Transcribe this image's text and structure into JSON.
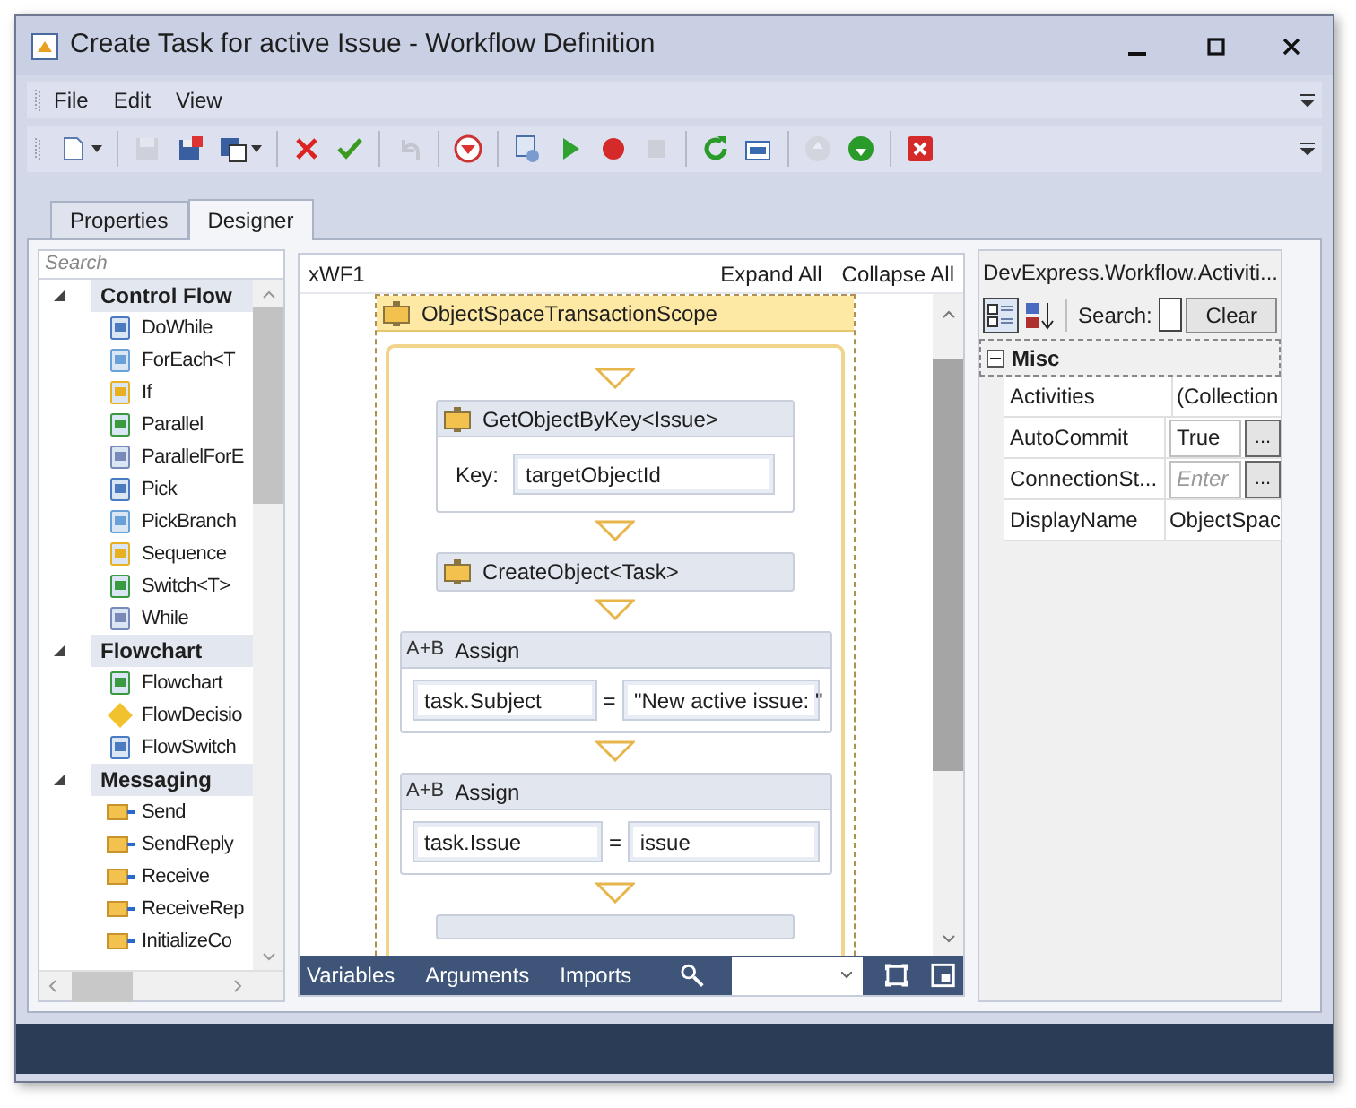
{
  "window": {
    "title": "Create Task for active Issue - Workflow Definition"
  },
  "menu": [
    "File",
    "Edit",
    "View"
  ],
  "toolbar": [
    [
      {
        "kind": "new",
        "disabled": false
      }
    ],
    [
      {
        "kind": "save",
        "disabled": true
      },
      {
        "kind": "save-close",
        "disabled": false
      },
      {
        "kind": "save-options",
        "disabled": false
      }
    ],
    [
      {
        "kind": "delete",
        "disabled": false
      },
      {
        "kind": "validate",
        "disabled": false
      }
    ],
    [
      {
        "kind": "undo",
        "disabled": true
      }
    ],
    [
      {
        "kind": "down-circle",
        "disabled": false
      }
    ],
    [
      {
        "kind": "diagram",
        "disabled": false
      },
      {
        "kind": "play",
        "disabled": false
      },
      {
        "kind": "record",
        "disabled": false
      },
      {
        "kind": "stop",
        "disabled": true
      }
    ],
    [
      {
        "kind": "refresh",
        "disabled": false
      },
      {
        "kind": "xml",
        "disabled": false
      }
    ],
    [
      {
        "kind": "up",
        "disabled": true
      },
      {
        "kind": "down",
        "disabled": false
      }
    ],
    [
      {
        "kind": "close",
        "disabled": false
      }
    ]
  ],
  "tabs": [
    {
      "label": "Properties",
      "selected": false
    },
    {
      "label": "Designer",
      "selected": true
    }
  ],
  "toolbox": {
    "search": {
      "placeholder": "Search"
    },
    "categories": [
      {
        "name": "Control Flow",
        "expanded": true,
        "items": [
          "DoWhile",
          "ForEach<T",
          "If",
          "Parallel",
          "ParallelForE",
          "Pick",
          "PickBranch",
          "Sequence",
          "Switch<T>",
          "While"
        ]
      },
      {
        "name": "Flowchart",
        "expanded": true,
        "items": [
          "Flowchart",
          "FlowDecisio",
          "FlowSwitch"
        ]
      },
      {
        "name": "Messaging",
        "expanded": true,
        "items": [
          "Send",
          "SendReply",
          "Receive",
          "ReceiveRep",
          "InitializeCo"
        ]
      }
    ]
  },
  "designer": {
    "breadcrumb": "xWF1",
    "expand_all": "Expand All",
    "collapse_all": "Collapse All",
    "scope": {
      "title": "ObjectSpaceTransactionScope",
      "activities": [
        {
          "kind": "key",
          "title": "GetObjectByKey<Issue>",
          "label": "Key:",
          "value": "targetObjectId"
        },
        {
          "kind": "simple",
          "title": "CreateObject<Task>"
        },
        {
          "kind": "assign",
          "icon": "A+B",
          "title": "Assign",
          "to": "task.Subject",
          "operator": "=",
          "value": "\"New active issue: \""
        },
        {
          "kind": "assign",
          "icon": "A+B",
          "title": "Assign",
          "to": "task.Issue",
          "operator": "=",
          "value": "issue"
        },
        {
          "kind": "partial"
        }
      ]
    },
    "bottom_tabs": [
      "Variables",
      "Arguments",
      "Imports"
    ]
  },
  "properties": {
    "title": "DevExpress.Workflow.Activiti...",
    "sort_modes": [
      {
        "kind": "categorized",
        "selected": true
      },
      {
        "kind": "alphabetical",
        "selected": false
      }
    ],
    "search_label": "Search:",
    "clear": "Clear",
    "category": {
      "name": "Misc",
      "expanded": true
    },
    "rows": [
      {
        "name": "Activities",
        "value": "(Collection"
      },
      {
        "name": "AutoCommit",
        "value": "True",
        "button": "..."
      },
      {
        "name": "ConnectionSt...",
        "placeholder": "Enter",
        "button": "..."
      },
      {
        "name": "DisplayName",
        "value": "ObjectSpac"
      }
    ]
  }
}
